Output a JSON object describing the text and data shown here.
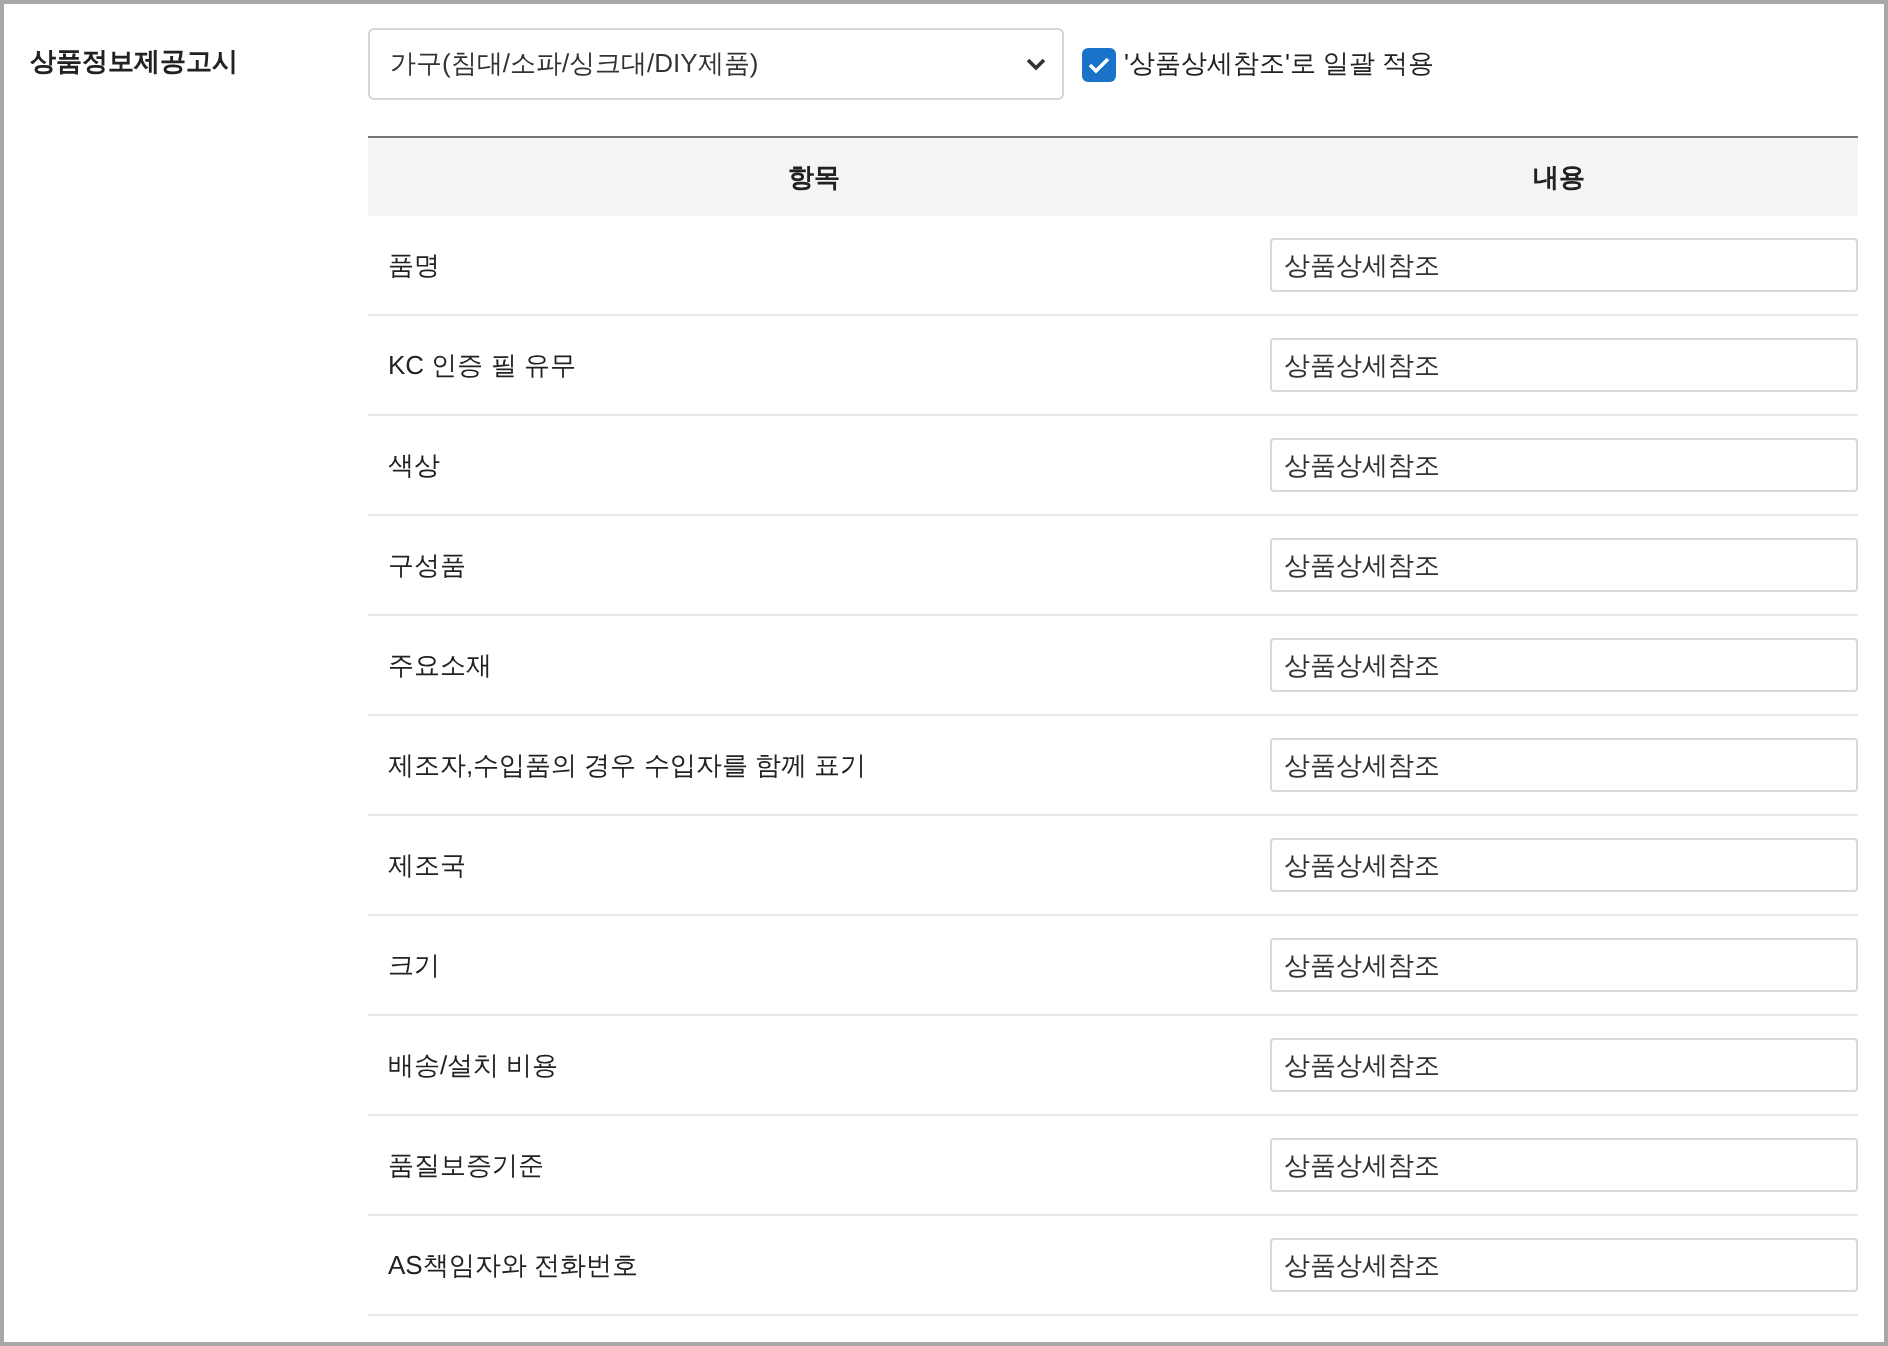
{
  "section_label": "상품정보제공고시",
  "category_select": {
    "value": "가구(침대/소파/싱크대/DIY제품)"
  },
  "bulk_apply": {
    "label": "'상품상세참조'로 일괄 적용",
    "checked": true
  },
  "table": {
    "columns": [
      "항목",
      "내용"
    ],
    "rows": [
      {
        "item": "품명",
        "value": "상품상세참조"
      },
      {
        "item": "KC 인증 필 유무",
        "value": "상품상세참조"
      },
      {
        "item": "색상",
        "value": "상품상세참조"
      },
      {
        "item": "구성품",
        "value": "상품상세참조"
      },
      {
        "item": "주요소재",
        "value": "상품상세참조"
      },
      {
        "item": "제조자,수입품의 경우 수입자를 함께 표기",
        "value": "상품상세참조"
      },
      {
        "item": "제조국",
        "value": "상품상세참조"
      },
      {
        "item": "크기",
        "value": "상품상세참조"
      },
      {
        "item": "배송/설치 비용",
        "value": "상품상세참조"
      },
      {
        "item": "품질보증기준",
        "value": "상품상세참조"
      },
      {
        "item": "AS책임자와 전화번호",
        "value": "상품상세참조"
      }
    ]
  }
}
